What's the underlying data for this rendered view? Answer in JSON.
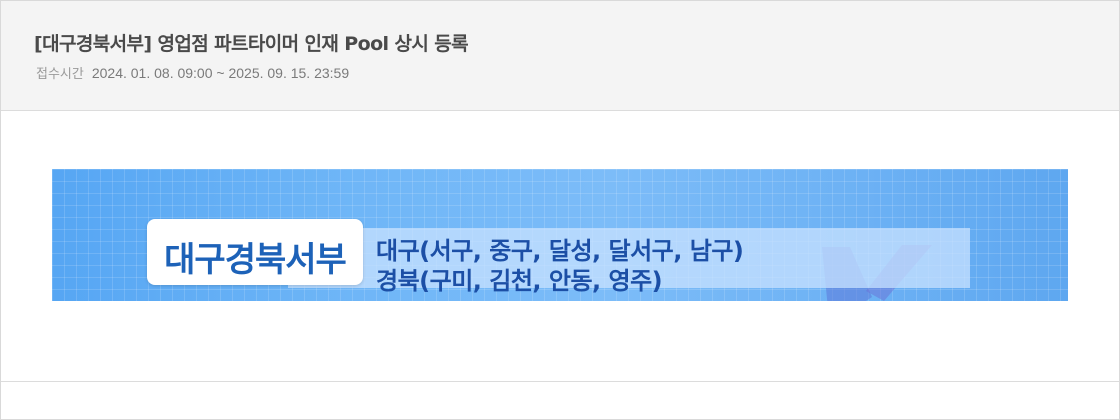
{
  "post": {
    "title": "[대구경북서부] 영업점 파트타이머 인재 Pool 상시 등록",
    "period_label": "접수시간",
    "period_value": "2024. 01. 08. 09:00 ~ 2025. 09. 15. 23:59"
  },
  "banner": {
    "region_name": "대구경북서부",
    "area_line_1": "대구(서구, 중구, 달성, 달서구, 남구)",
    "area_line_2": "경북(구미, 김천, 안동, 영주)"
  },
  "colors": {
    "header_bg": "#f4f4f4",
    "banner_blue": "#6fb6f7",
    "region_text": "#1d62b8",
    "area_text": "#1c4fa6"
  }
}
